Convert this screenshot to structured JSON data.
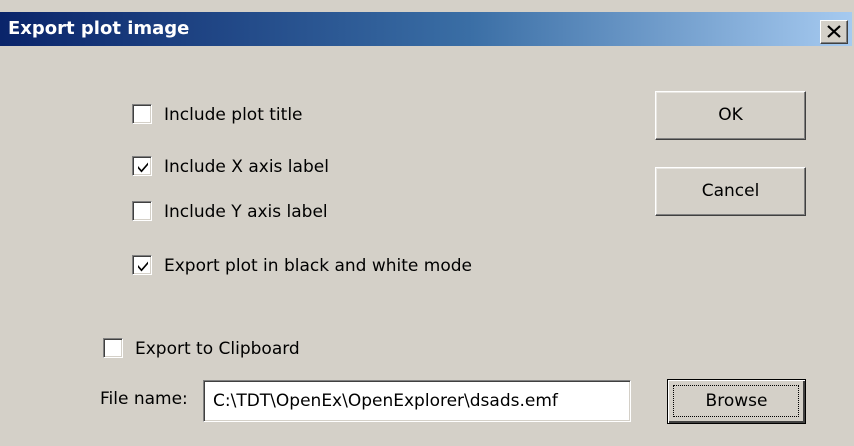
{
  "window": {
    "title": "Export plot image",
    "close_icon": "close-icon"
  },
  "options": [
    {
      "label": "Include plot title",
      "checked": false
    },
    {
      "label": "Include X axis label",
      "checked": true
    },
    {
      "label": "Include Y axis label",
      "checked": false
    },
    {
      "label": "Export plot in black and white mode",
      "checked": true
    }
  ],
  "clipboard": {
    "label": "Export to Clipboard",
    "checked": false
  },
  "buttons": {
    "ok": "OK",
    "cancel": "Cancel",
    "browse": "Browse"
  },
  "file": {
    "label": "File name:",
    "value": "C:\\TDT\\OpenEx\\OpenExplorer\\dsads.emf"
  }
}
